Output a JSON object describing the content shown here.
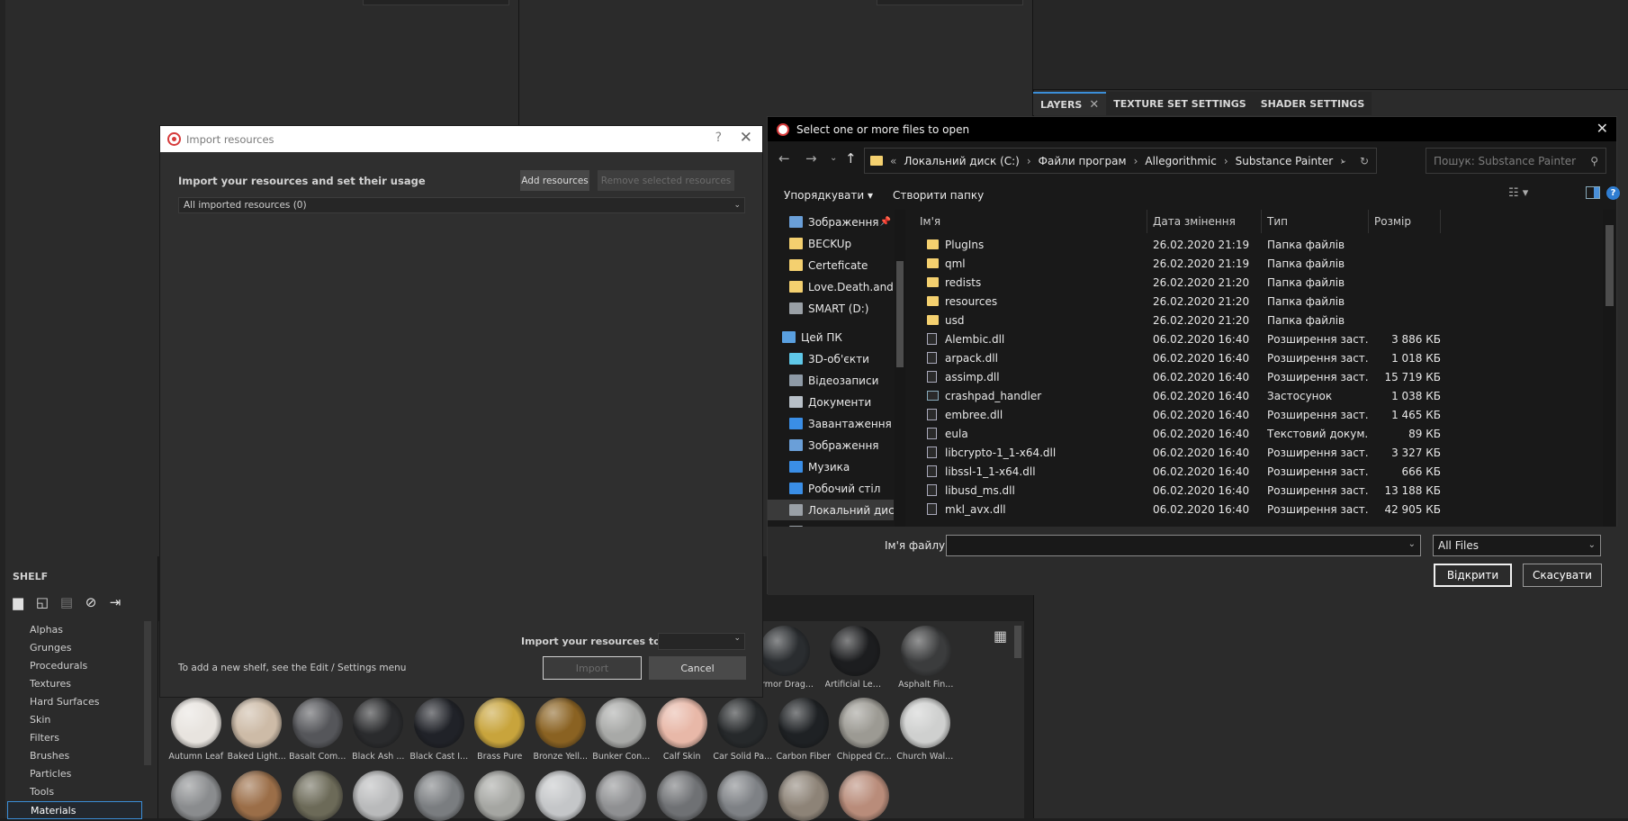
{
  "panel_tabs": [
    {
      "label": "LAYERS"
    },
    {
      "label": "TEXTURE SET SETTINGS"
    },
    {
      "label": "SHADER SETTINGS"
    }
  ],
  "shelf": {
    "title": "SHELF",
    "icons": [
      "folder-icon",
      "new-file-icon",
      "save-icon",
      "hide-icon",
      "import-icon"
    ],
    "items": [
      {
        "label": "Alphas"
      },
      {
        "label": "Grunges"
      },
      {
        "label": "Procedurals"
      },
      {
        "label": "Textures"
      },
      {
        "label": "Hard Surfaces"
      },
      {
        "label": "Skin"
      },
      {
        "label": "Filters"
      },
      {
        "label": "Brushes"
      },
      {
        "label": "Particles"
      },
      {
        "label": "Tools"
      },
      {
        "label": "Materials"
      }
    ],
    "selected_item": "Materials"
  },
  "materials_top": [
    {
      "label": "Armor Drag...",
      "color": "#2a2d30"
    },
    {
      "label": "Artificial Lea...",
      "color": "#1c1d1f"
    },
    {
      "label": "Asphalt Fin...",
      "color": "#3b3c3d"
    }
  ],
  "materials": [
    {
      "label": "Autumn Leaf",
      "color": "#e8e4df"
    },
    {
      "label": "Baked Light...",
      "color": "#cdbba7"
    },
    {
      "label": "Basalt Com...",
      "color": "#55565a"
    },
    {
      "label": "Black Ash ...",
      "color": "#2a2b2d"
    },
    {
      "label": "Black Cast I...",
      "color": "#202228"
    },
    {
      "label": "Brass Pure",
      "color": "#c8a43c"
    },
    {
      "label": "Bronze Yell...",
      "color": "#8a6222"
    },
    {
      "label": "Bunker Con...",
      "color": "#a8a9a7"
    },
    {
      "label": "Calf Skin",
      "color": "#e8b8a8"
    },
    {
      "label": "Car Solid Pa...",
      "color": "#26292b"
    },
    {
      "label": "Carbon Fiber",
      "color": "#1e2124"
    },
    {
      "label": "Chipped Cr...",
      "color": "#9c9a93"
    },
    {
      "label": "Church Wal...",
      "color": "#cfd0cf"
    },
    {
      "label": "",
      "color": "#8a8c8e"
    },
    {
      "label": "",
      "color": "#9b6e48"
    },
    {
      "label": "",
      "color": "#6c6a58"
    },
    {
      "label": "",
      "color": "#b9babb"
    },
    {
      "label": "",
      "color": "#7a7d80"
    },
    {
      "label": "",
      "color": "#a5a6a2"
    },
    {
      "label": "",
      "color": "#c4c6c8"
    },
    {
      "label": "",
      "color": "#8f9092"
    },
    {
      "label": "",
      "color": "#6f7174"
    },
    {
      "label": "",
      "color": "#7e8185"
    },
    {
      "label": "",
      "color": "#8d8377"
    },
    {
      "label": "",
      "color": "#b98c7a"
    }
  ],
  "import_dialog": {
    "title": "Import resources",
    "help": "?",
    "close": "✕",
    "heading": "Import your resources and set their usage",
    "add_button": "Add resources",
    "remove_button": "Remove selected resources",
    "filter_value": "All imported resources (0)",
    "import_to_label": "Import your resources to:",
    "import_to_value": "",
    "hint": "To add a new shelf, see the Edit / Settings menu",
    "import_button": "Import",
    "cancel_button": "Cancel"
  },
  "file_dialog": {
    "title": "Select one or more files to open",
    "close": "✕",
    "address": {
      "prefix": "«",
      "crumbs": [
        "Локальний диск (C:)",
        "Файли програм",
        "Allegorithmic",
        "Substance Painter"
      ]
    },
    "search_placeholder": "Пошук: Substance Painter",
    "organize": "Упорядкувати ▾",
    "new_folder": "Створити папку",
    "columns": {
      "name": "Ім'я",
      "date": "Дата змінення",
      "type": "Тип",
      "size": "Розмір"
    },
    "tree": [
      {
        "label": "Зображення",
        "icon": "pictures-icon",
        "pinned": true,
        "color": "#6a9fd8"
      },
      {
        "label": "BECKUp",
        "icon": "folder-icon",
        "color": "#f4d06f"
      },
      {
        "label": "Certeficate",
        "icon": "folder-icon",
        "color": "#f4d06f"
      },
      {
        "label": "Love.Death.and.",
        "icon": "folder-icon",
        "color": "#f4d06f"
      },
      {
        "label": "SMART (D:)",
        "icon": "drive-icon",
        "color": "#9aa0a6"
      },
      {
        "label": "Цей ПК",
        "icon": "computer-icon",
        "color": "#5aa0e0"
      },
      {
        "label": "3D-об'єкти",
        "icon": "3d-objects-icon",
        "color": "#5fc8e8"
      },
      {
        "label": "Відеозаписи",
        "icon": "videos-icon",
        "color": "#8e9aa6"
      },
      {
        "label": "Документи",
        "icon": "documents-icon",
        "color": "#b8c0c8"
      },
      {
        "label": "Завантаження",
        "icon": "downloads-icon",
        "color": "#3a8ee6"
      },
      {
        "label": "Зображення",
        "icon": "pictures-icon",
        "color": "#6a9fd8"
      },
      {
        "label": "Музика",
        "icon": "music-icon",
        "color": "#3a8ee6"
      },
      {
        "label": "Робочий стіл",
        "icon": "desktop-icon",
        "color": "#3a8ee6"
      },
      {
        "label": "Локальний диск",
        "icon": "drive-icon",
        "color": "#9aa0a6",
        "selected": true
      },
      {
        "label": "SMART (D:)",
        "icon": "drive-icon",
        "color": "#9aa0a6"
      }
    ],
    "files": [
      {
        "name": "PlugIns",
        "date": "26.02.2020 21:19",
        "type": "Папка файлів",
        "size": "",
        "kind": "folder"
      },
      {
        "name": "qml",
        "date": "26.02.2020 21:19",
        "type": "Папка файлів",
        "size": "",
        "kind": "folder"
      },
      {
        "name": "redists",
        "date": "26.02.2020 21:20",
        "type": "Папка файлів",
        "size": "",
        "kind": "folder"
      },
      {
        "name": "resources",
        "date": "26.02.2020 21:20",
        "type": "Папка файлів",
        "size": "",
        "kind": "folder"
      },
      {
        "name": "usd",
        "date": "26.02.2020 21:20",
        "type": "Папка файлів",
        "size": "",
        "kind": "folder"
      },
      {
        "name": "Alembic.dll",
        "date": "06.02.2020 16:40",
        "type": "Розширення заст...",
        "size": "3 886 КБ",
        "kind": "file"
      },
      {
        "name": "arpack.dll",
        "date": "06.02.2020 16:40",
        "type": "Розширення заст...",
        "size": "1 018 КБ",
        "kind": "file"
      },
      {
        "name": "assimp.dll",
        "date": "06.02.2020 16:40",
        "type": "Розширення заст...",
        "size": "15 719 КБ",
        "kind": "file"
      },
      {
        "name": "crashpad_handler",
        "date": "06.02.2020 16:40",
        "type": "Застосунок",
        "size": "1 038 КБ",
        "kind": "exe"
      },
      {
        "name": "embree.dll",
        "date": "06.02.2020 16:40",
        "type": "Розширення заст...",
        "size": "1 465 КБ",
        "kind": "file"
      },
      {
        "name": "eula",
        "date": "06.02.2020 16:40",
        "type": "Текстовий докум...",
        "size": "89 КБ",
        "kind": "file"
      },
      {
        "name": "libcrypto-1_1-x64.dll",
        "date": "06.02.2020 16:40",
        "type": "Розширення заст...",
        "size": "3 327 КБ",
        "kind": "file"
      },
      {
        "name": "libssl-1_1-x64.dll",
        "date": "06.02.2020 16:40",
        "type": "Розширення заст...",
        "size": "666 КБ",
        "kind": "file"
      },
      {
        "name": "libusd_ms.dll",
        "date": "06.02.2020 16:40",
        "type": "Розширення заст...",
        "size": "13 188 КБ",
        "kind": "file"
      },
      {
        "name": "mkl_avx.dll",
        "date": "06.02.2020 16:40",
        "type": "Розширення заст...",
        "size": "42 905 КБ",
        "kind": "file"
      }
    ],
    "filename_label": "Ім'я файлу:",
    "filename_value": "",
    "filetype_value": "All Files",
    "open_button": "Відкрити",
    "cancel_button": "Скасувати"
  }
}
